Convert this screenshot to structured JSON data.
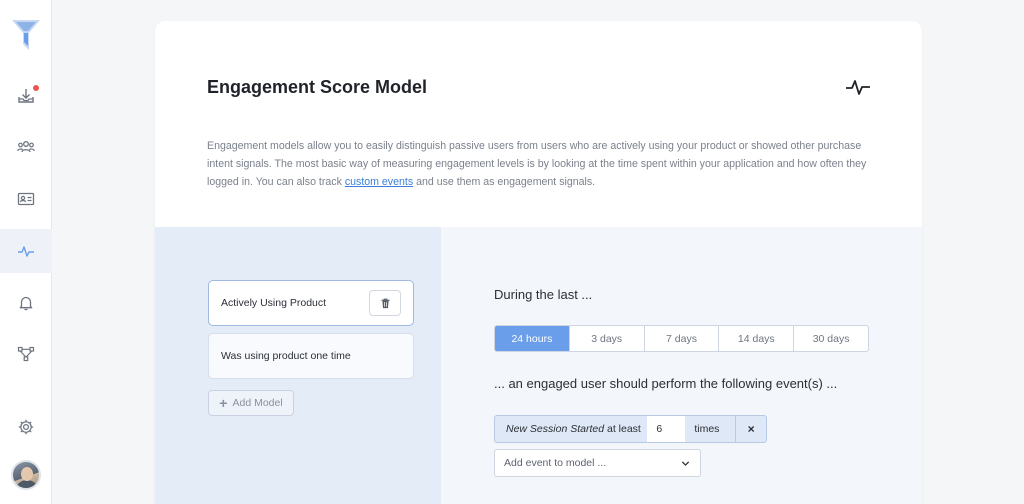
{
  "sidebar": {
    "items": [
      {
        "name": "download-icon",
        "has_notification": true
      },
      {
        "name": "users-icon"
      },
      {
        "name": "contact-card-icon"
      },
      {
        "name": "activity-icon",
        "active": true
      },
      {
        "name": "bell-icon"
      },
      {
        "name": "flow-icon"
      },
      {
        "name": "gear-icon"
      }
    ]
  },
  "card": {
    "title": "Engagement Score Model",
    "description_before_link": "Engagement models allow you to easily distinguish passive users from users who are actively using your product or showed other purchase intent signals. The most basic way of measuring engagement levels is by looking at the time spent within your application and how often they logged in. You can also track ",
    "description_link": "custom events",
    "description_after_link": " and use them as engagement signals."
  },
  "models": {
    "items": [
      {
        "label": "Actively Using Product",
        "selected": true
      },
      {
        "label": "Was using product one time",
        "selected": false
      }
    ],
    "add_label": "Add Model"
  },
  "editor": {
    "during_label": "During the last ...",
    "periods": [
      "24 hours",
      "3 days",
      "7 days",
      "14 days",
      "30 days"
    ],
    "active_period": "24 hours",
    "engaged_label": "... an engaged user should perform the following event(s) ...",
    "event": {
      "name": "New Session Started",
      "qualifier": "at least",
      "count": "6",
      "unit": "times",
      "remove": "×"
    },
    "add_event_placeholder": "Add event to model ..."
  },
  "colors": {
    "accent": "#6b9eea",
    "link": "#3d7fd8",
    "notification": "#f0554d"
  }
}
